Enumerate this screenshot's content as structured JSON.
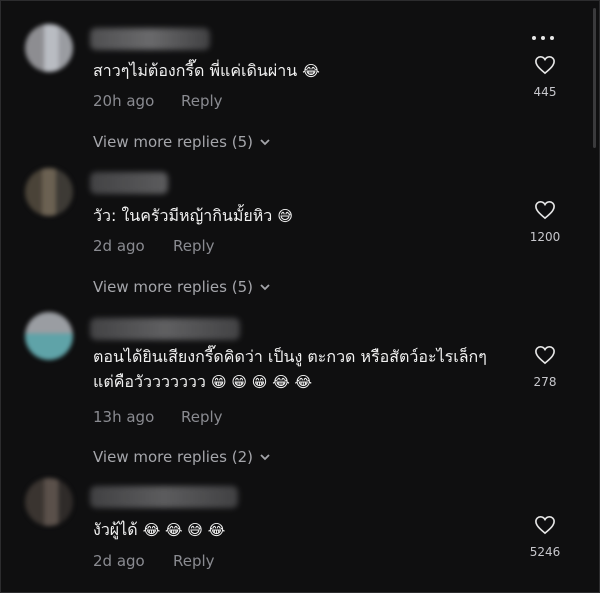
{
  "colors": {
    "background": "#0f0f10",
    "muted_text": "#8a8b91",
    "view_more": "#a5a6ab"
  },
  "comments": [
    {
      "text": "สาวๆไม่ต้องกรี๊ด พี่แค่เดินผ่าน",
      "emoji": "😂",
      "time": "20h ago",
      "reply_label": "Reply",
      "likes": "445",
      "view_more": "View more replies (5)"
    },
    {
      "text": "วัว: ในครัวมีหญ้ากินมั้ยหิว",
      "emoji": "😅",
      "time": "2d ago",
      "reply_label": "Reply",
      "likes": "1200",
      "view_more": "View more replies (5)"
    },
    {
      "text_line1": "ตอนได้ยินเสียงกรี๊ดคิดว่า เป็นงู ตะกวด หรือสัตว์อะไรเล็กๆ",
      "text_line2": "แต่คือวัววววววว",
      "emoji": "😁 😁 😁 😂 😂",
      "time": "13h ago",
      "reply_label": "Reply",
      "likes": "278",
      "view_more": "View more replies (2)"
    },
    {
      "text": "งัวผู้ได้",
      "emoji": "😂 😂 😅 😂",
      "time": "2d ago",
      "reply_label": "Reply",
      "likes": "5246"
    }
  ]
}
